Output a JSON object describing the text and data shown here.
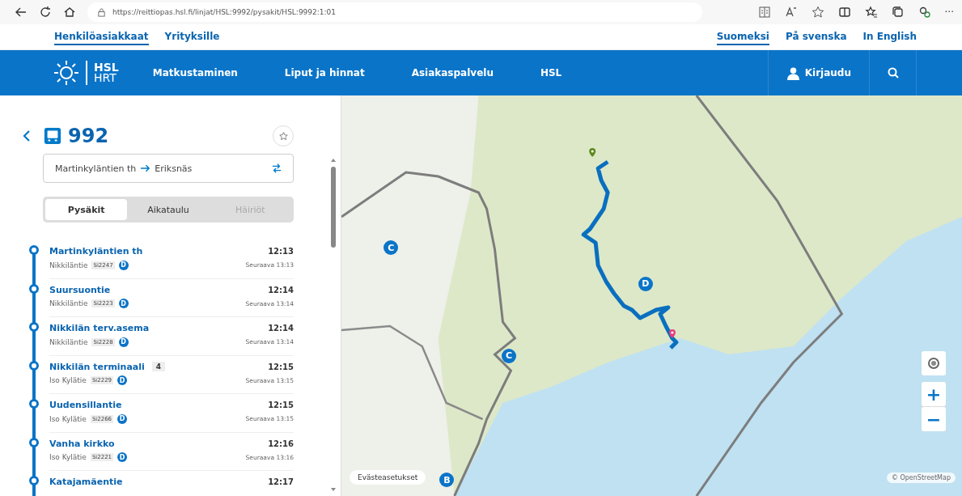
{
  "browser": {
    "url": "https://reittiopas.hsl.fi/linjat/HSL:9992/pysakit/HSL:9992:1:01",
    "more": "···"
  },
  "audience_links": [
    {
      "label": "Henkilöasiakkaat",
      "selected": true
    },
    {
      "label": "Yrityksille",
      "selected": false
    }
  ],
  "languages": [
    {
      "label": "Suomeksi",
      "selected": true
    },
    {
      "label": "På svenska",
      "selected": false
    },
    {
      "label": "In English",
      "selected": false
    }
  ],
  "nav": {
    "logo_top": "HSL",
    "logo_bottom": "HRT",
    "items": [
      "Matkustaminen",
      "Liput ja hinnat",
      "Asiakaspalvelu",
      "HSL"
    ],
    "login": "Kirjaudu"
  },
  "route": {
    "number": "992",
    "origin": "Martinkyläntien th",
    "destination": "Eriksnäs"
  },
  "tabs": [
    {
      "label": "Pysäkit",
      "selected": true,
      "disabled": false
    },
    {
      "label": "Aikataulu",
      "selected": false,
      "disabled": false
    },
    {
      "label": "Häiriöt",
      "selected": false,
      "disabled": true
    }
  ],
  "stops": [
    {
      "name": "Martinkyläntien th",
      "street": "Nikkiläntie",
      "code": "Si2247",
      "zone": "D",
      "time": "12:13",
      "next": "Seuraava 13:13"
    },
    {
      "name": "Suursuontie",
      "street": "Nikkiläntie",
      "code": "Si2223",
      "zone": "D",
      "time": "12:14",
      "next": "Seuraava 13:14"
    },
    {
      "name": "Nikkilän terv.asema",
      "street": "Nikkiläntie",
      "code": "Si2228",
      "zone": "D",
      "time": "12:14",
      "next": "Seuraava 13:14"
    },
    {
      "name": "Nikkilän terminaali",
      "platform": "4",
      "street": "Iso Kylätie",
      "code": "Si2229",
      "zone": "D",
      "time": "12:15",
      "next": "Seuraava 13:15"
    },
    {
      "name": "Uudensillantie",
      "street": "Iso Kylätie",
      "code": "Si2266",
      "zone": "D",
      "time": "12:15",
      "next": "Seuraava 13:15"
    },
    {
      "name": "Vanha kirkko",
      "street": "Iso Kylätie",
      "code": "Si2221",
      "zone": "D",
      "time": "12:16",
      "next": "Seuraava 13:16"
    },
    {
      "name": "Katajamäentie",
      "time": "12:17"
    }
  ],
  "map": {
    "zones": [
      {
        "label": "C"
      },
      {
        "label": "D"
      },
      {
        "label": "C"
      },
      {
        "label": "B"
      }
    ],
    "cookie_button": "Evästeasetukset",
    "attribution": "© OpenStreetMap",
    "zoom_in": "+",
    "zoom_out": "−"
  }
}
